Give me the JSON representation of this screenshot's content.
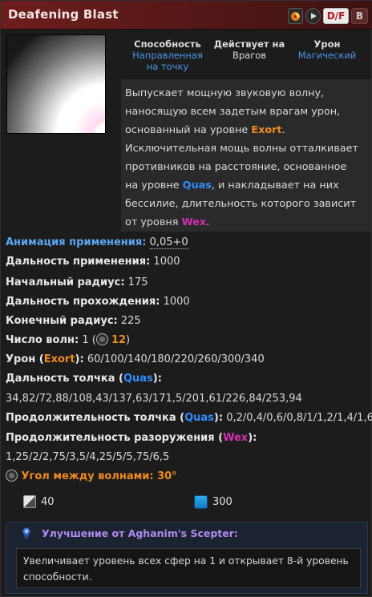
{
  "header": {
    "title": "Deafening Blast",
    "df_label": "D/F",
    "b_label": "B",
    "colors": {
      "header_start": "#6e1d1d",
      "header_end": "#3d1212"
    }
  },
  "ability": {
    "art_icon": "deafening-blast-art",
    "stats": [
      {
        "label": "Способность",
        "value_line1": "Направленная",
        "value_line2": "на точку"
      },
      {
        "label": "Действует на",
        "value_line1": "Врагов",
        "value_line2": ""
      },
      {
        "label": "Урон",
        "value_line1": "Магический",
        "value_line2": ""
      }
    ],
    "description": {
      "l1": "Выпускает мощную звуковую волну,",
      "l2": "наносящую всем задетым врагам урон,",
      "l3_pre": "основанный на уровне ",
      "l3_exort": "Exort",
      "l3_post": ".",
      "l4": "Исключительная мощь волны отталкивает",
      "l5": "противников на расстояние, основанное",
      "l6_pre": "на уровне ",
      "l6_quas": "Quas",
      "l6_post": ", и накладывает на них",
      "l7": "бессилие, длительность которого зависит",
      "l8_pre": "от уровня ",
      "l8_wex": "Wex",
      "l8_post": "."
    }
  },
  "attributes": {
    "cast_anim_label": "Анимация применения:",
    "cast_anim_value": "0,05+0",
    "cast_range_label": "Дальность применения:",
    "cast_range_value": "1000",
    "start_radius_label": "Начальный радиус:",
    "start_radius_value": "175",
    "travel_label": "Дальность прохождения:",
    "travel_value": "1000",
    "end_radius_label": "Конечный радиус:",
    "end_radius_value": "225",
    "waves_label": "Число волн:",
    "waves_value": "1",
    "waves_talent_value": "12",
    "damage_label_pre": "Урон (",
    "damage_exort": "Exort",
    "damage_label_post": "):",
    "damage_value": "60/100/140/180/220/260/300/340",
    "knock_dist_label_pre": "Дальность толчка (",
    "knock_dist_quas": "Quas",
    "knock_dist_label_post": "):",
    "knock_dist_value": "34,82/72,88/108,43/137,63/171,5/201,61/226,84/253,94",
    "knock_dur_label_pre": "Продолжительность толчка (",
    "knock_dur_quas": "Quas",
    "knock_dur_label_post": "):",
    "knock_dur_value": "0,2/0,4/0,6/0,8/1/1,2/1,4/1,6",
    "disarm_label_pre": "Продолжительность разоружения (",
    "disarm_wex": "Wex",
    "disarm_label_post": "):",
    "disarm_value": "1,25/2/2,75/3,5/4,25/5/5,75/6,5",
    "talent_label": "Угол между волнами: 30°"
  },
  "costs": {
    "cooldown": "40",
    "mana": "300"
  },
  "scepter": {
    "title": "Улучшение от Aghanim's Scepter:",
    "body_l1": "Увеличивает уровень всех сфер на 1 и открывает 8-й уровень",
    "body_l2": "способности."
  }
}
